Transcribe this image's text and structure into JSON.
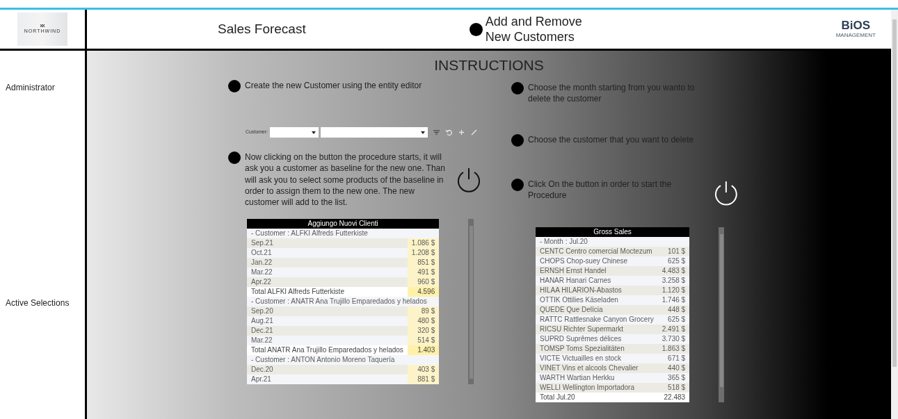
{
  "header": {
    "logo_text": "NORTHWIND",
    "title": "Sales Forecast",
    "subtitle": "Add and Remove New Customers",
    "brand_name": "BiOS",
    "brand_tagline": "MANAGEMENT"
  },
  "sidebar": {
    "items": [
      {
        "label": "Administrator"
      },
      {
        "label": "Active Selections"
      }
    ]
  },
  "instructions": {
    "title": "INSTRUCTIONS",
    "add_steps": [
      {
        "kind": "text",
        "text": "Create the new Customer using the entity editor"
      },
      {
        "kind": "editor",
        "label": "Customer:",
        "tools": [
          {
            "kind": "filter",
            "disabled": false
          },
          {
            "kind": "undo",
            "disabled": true
          },
          {
            "kind": "plus",
            "disabled": true
          },
          {
            "kind": "pencil",
            "disabled": true
          }
        ]
      },
      {
        "kind": "button",
        "text": "Now clicking on the button the procedure starts, it will ask you a customer as baseline for the new one. Than will ask you to select some products of the baseline in order to assign them to the new one. The new customer will add to the list."
      }
    ],
    "remove_steps": [
      {
        "kind": "text",
        "text": "Choose the month starting from you wanto to delete the customer"
      },
      {
        "kind": "text",
        "text": "Choose the customer that you want to delete"
      },
      {
        "kind": "button",
        "text": "Click On the button in order to start the Procedure"
      }
    ]
  },
  "tables": [
    {
      "title": "Aggiungo Nuovi Clienti",
      "highlight_values": true,
      "rows": [
        {
          "kind": "group",
          "label": "- Customer : ALFKI Alfreds Futterkiste"
        },
        {
          "kind": "item",
          "label": "Sep.21",
          "value": "1.086 $"
        },
        {
          "kind": "item",
          "label": "Oct.21",
          "value": "1.208 $"
        },
        {
          "kind": "item",
          "label": "Jan.22",
          "value": "851 $"
        },
        {
          "kind": "item",
          "label": "Mar.22",
          "value": "491 $"
        },
        {
          "kind": "item",
          "label": "Apr.22",
          "value": "960 $"
        },
        {
          "kind": "total",
          "label": "Total ALFKI Alfreds Futterkiste",
          "value": "4.596"
        },
        {
          "kind": "group",
          "label": "- Customer : ANATR Ana Trujillo Emparedados y helados"
        },
        {
          "kind": "item",
          "label": "Sep.20",
          "value": "89 $"
        },
        {
          "kind": "item",
          "label": "Aug.21",
          "value": "480 $"
        },
        {
          "kind": "item",
          "label": "Dec.21",
          "value": "320 $"
        },
        {
          "kind": "item",
          "label": "Mar.22",
          "value": "514 $"
        },
        {
          "kind": "total",
          "label": "Total ANATR Ana Trujillo Emparedados y helados",
          "value": "1.403"
        },
        {
          "kind": "group",
          "label": "- Customer : ANTON Antonio Moreno Taquería"
        },
        {
          "kind": "item",
          "label": "Dec.20",
          "value": "403 $"
        },
        {
          "kind": "item",
          "label": "Apr.21",
          "value": "881 $"
        }
      ]
    },
    {
      "title": "Gross Sales",
      "highlight_values": false,
      "rows": [
        {
          "kind": "group",
          "label": "- Month : Jul.20"
        },
        {
          "kind": "item",
          "label": "CENTC Centro comercial Moctezum",
          "value": "101 $"
        },
        {
          "kind": "item",
          "label": "CHOPS Chop-suey Chinese",
          "value": "625 $"
        },
        {
          "kind": "item",
          "label": "ERNSH Ernst Handel",
          "value": "4.483 $"
        },
        {
          "kind": "item",
          "label": "HANAR Hanari Carnes",
          "value": "3.258 $"
        },
        {
          "kind": "item",
          "label": "HILAA HILARION-Abastos",
          "value": "1.120 $"
        },
        {
          "kind": "item",
          "label": "OTTIK Ottilies Käseladen",
          "value": "1.746 $"
        },
        {
          "kind": "item",
          "label": "QUEDE Que Delícia",
          "value": "448 $"
        },
        {
          "kind": "item",
          "label": "RATTC Rattlesnake Canyon Grocery",
          "value": "625 $"
        },
        {
          "kind": "item",
          "label": "RICSU Richter Supermarkt",
          "value": "2.491 $"
        },
        {
          "kind": "item",
          "label": "SUPRD Suprêmes délices",
          "value": "3.730 $"
        },
        {
          "kind": "item",
          "label": "TOMSP Toms Spezialitäten",
          "value": "1.863 $"
        },
        {
          "kind": "item",
          "label": "VICTE Victuailles en stock",
          "value": "671 $"
        },
        {
          "kind": "item",
          "label": "VINET Vins et alcools Chevalier",
          "value": "440 $"
        },
        {
          "kind": "item",
          "label": "WARTH Wartian Herkku",
          "value": "365 $"
        },
        {
          "kind": "item",
          "label": "WELLI Wellington Importadora",
          "value": "518 $"
        },
        {
          "kind": "total",
          "label": "Total Jul.20",
          "value": "22.483"
        }
      ]
    }
  ]
}
